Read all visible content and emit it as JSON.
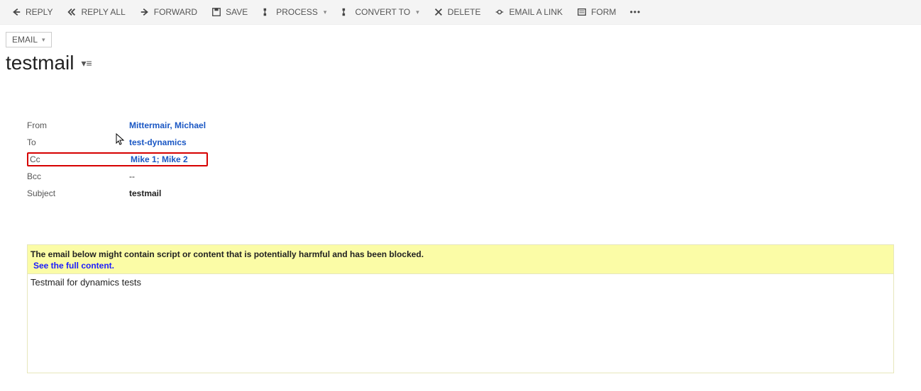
{
  "toolbar": {
    "reply": "Reply",
    "reply_all": "Reply All",
    "forward": "Forward",
    "save": "Save",
    "process": "Process",
    "convert_to": "Convert To",
    "delete": "Delete",
    "email_link": "Email a Link",
    "form": "Form"
  },
  "record": {
    "type_label": "Email",
    "title": "testmail"
  },
  "fields": {
    "from_label": "From",
    "from_value": "Mittermair, Michael",
    "to_label": "To",
    "to_value": "test-dynamics",
    "cc_label": "Cc",
    "cc_value": "Mike 1; Mike 2",
    "bcc_label": "Bcc",
    "bcc_value": "--",
    "subject_label": "Subject",
    "subject_value": "testmail"
  },
  "body": {
    "warning": "The email below might contain script or content that is potentially harmful and has been blocked.",
    "full_content_link": "See the full content.",
    "text": "Testmail for dynamics tests"
  }
}
